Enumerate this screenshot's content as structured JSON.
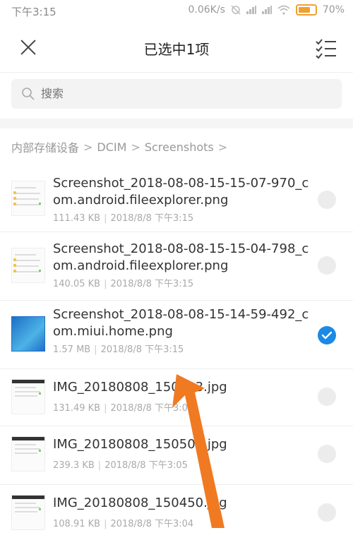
{
  "status_bar": {
    "time": "下午3:15",
    "network_speed": "0.06K/s",
    "battery": "70%"
  },
  "header": {
    "title": "已选中1项"
  },
  "search": {
    "placeholder": "搜索"
  },
  "breadcrumb": {
    "items": [
      "内部存储设备",
      "DCIM",
      "Screenshots"
    ],
    "separator": ">"
  },
  "files": [
    {
      "name": "Screenshot_2018-08-08-15-15-07-970_com.android.fileexplorer.png",
      "size": "111.43 KB",
      "date": "2018/8/8 下午3:15",
      "selected": false,
      "thumb": "screenshot-light"
    },
    {
      "name": "Screenshot_2018-08-08-15-15-04-798_com.android.fileexplorer.png",
      "size": "140.05 KB",
      "date": "2018/8/8 下午3:15",
      "selected": false,
      "thumb": "screenshot-light"
    },
    {
      "name": "Screenshot_2018-08-08-15-14-59-492_com.miui.home.png",
      "size": "1.57 MB",
      "date": "2018/8/8 下午3:15",
      "selected": true,
      "thumb": "home-blue"
    },
    {
      "name": "IMG_20180808_150513.jpg",
      "size": "131.49 KB",
      "date": "2018/8/8 下午3:05",
      "selected": false,
      "thumb": "image-dark"
    },
    {
      "name": "IMG_20180808_150502.jpg",
      "size": "239.3 KB",
      "date": "2018/8/8 下午3:05",
      "selected": false,
      "thumb": "image-dark"
    },
    {
      "name": "IMG_20180808_150450.jpg",
      "size": "108.91 KB",
      "date": "2018/8/8 下午3:04",
      "selected": false,
      "thumb": "image-dark"
    }
  ],
  "colors": {
    "accent": "#1a8ae6",
    "arrow": "#f07a22"
  }
}
